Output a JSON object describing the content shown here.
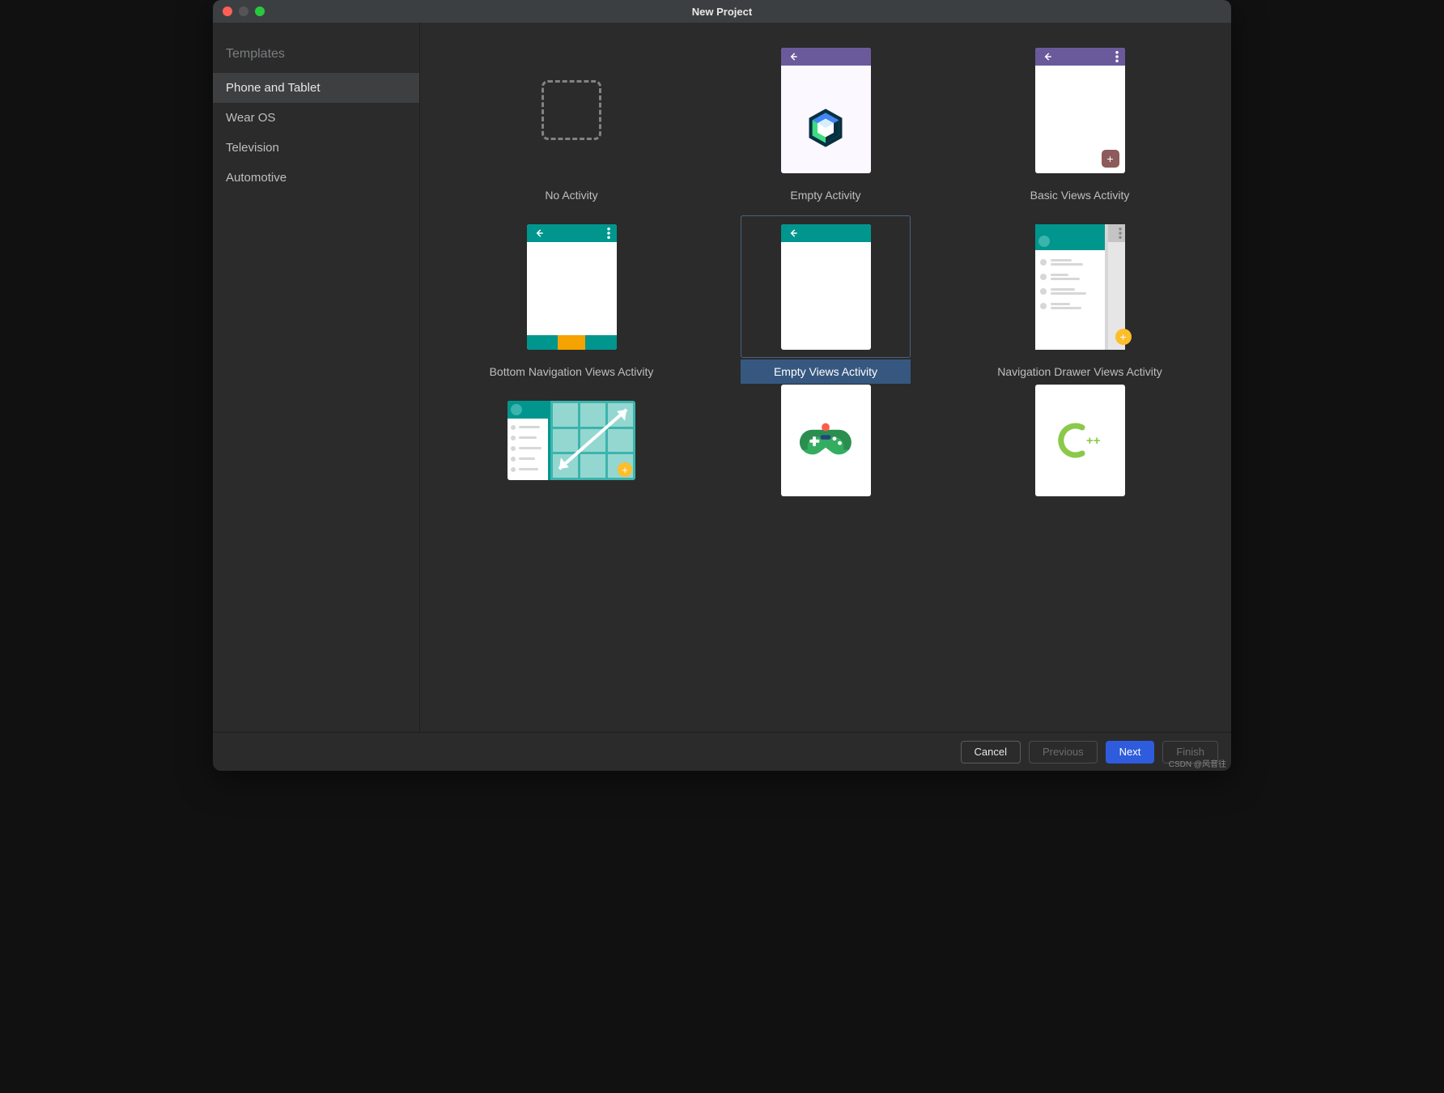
{
  "window": {
    "title": "New Project"
  },
  "sidebar": {
    "heading": "Templates",
    "items": [
      {
        "label": "Phone and Tablet",
        "selected": true
      },
      {
        "label": "Wear OS",
        "selected": false
      },
      {
        "label": "Television",
        "selected": false
      },
      {
        "label": "Automotive",
        "selected": false
      }
    ]
  },
  "templates": [
    {
      "id": "no-activity",
      "label": "No Activity",
      "selected": false
    },
    {
      "id": "empty-activity",
      "label": "Empty Activity",
      "selected": false
    },
    {
      "id": "basic-views-activity",
      "label": "Basic Views Activity",
      "selected": false
    },
    {
      "id": "bottom-nav-views-activity",
      "label": "Bottom Navigation Views Activity",
      "selected": false
    },
    {
      "id": "empty-views-activity",
      "label": "Empty Views Activity",
      "selected": true
    },
    {
      "id": "nav-drawer-views-activity",
      "label": "Navigation Drawer Views Activity",
      "selected": false
    },
    {
      "id": "responsive-views-activity",
      "label": "",
      "selected": false
    },
    {
      "id": "game-activity",
      "label": "",
      "selected": false
    },
    {
      "id": "native-cpp",
      "label": "",
      "selected": false
    }
  ],
  "cpp_label": "++",
  "buttons": {
    "cancel": "Cancel",
    "previous": "Previous",
    "next": "Next",
    "finish": "Finish"
  },
  "watermark": "CSDN @风音往",
  "colors": {
    "accent_purple": "#6a5a9b",
    "accent_teal": "#00968d",
    "primary_btn": "#2f5cdc",
    "selection": "#365880"
  }
}
